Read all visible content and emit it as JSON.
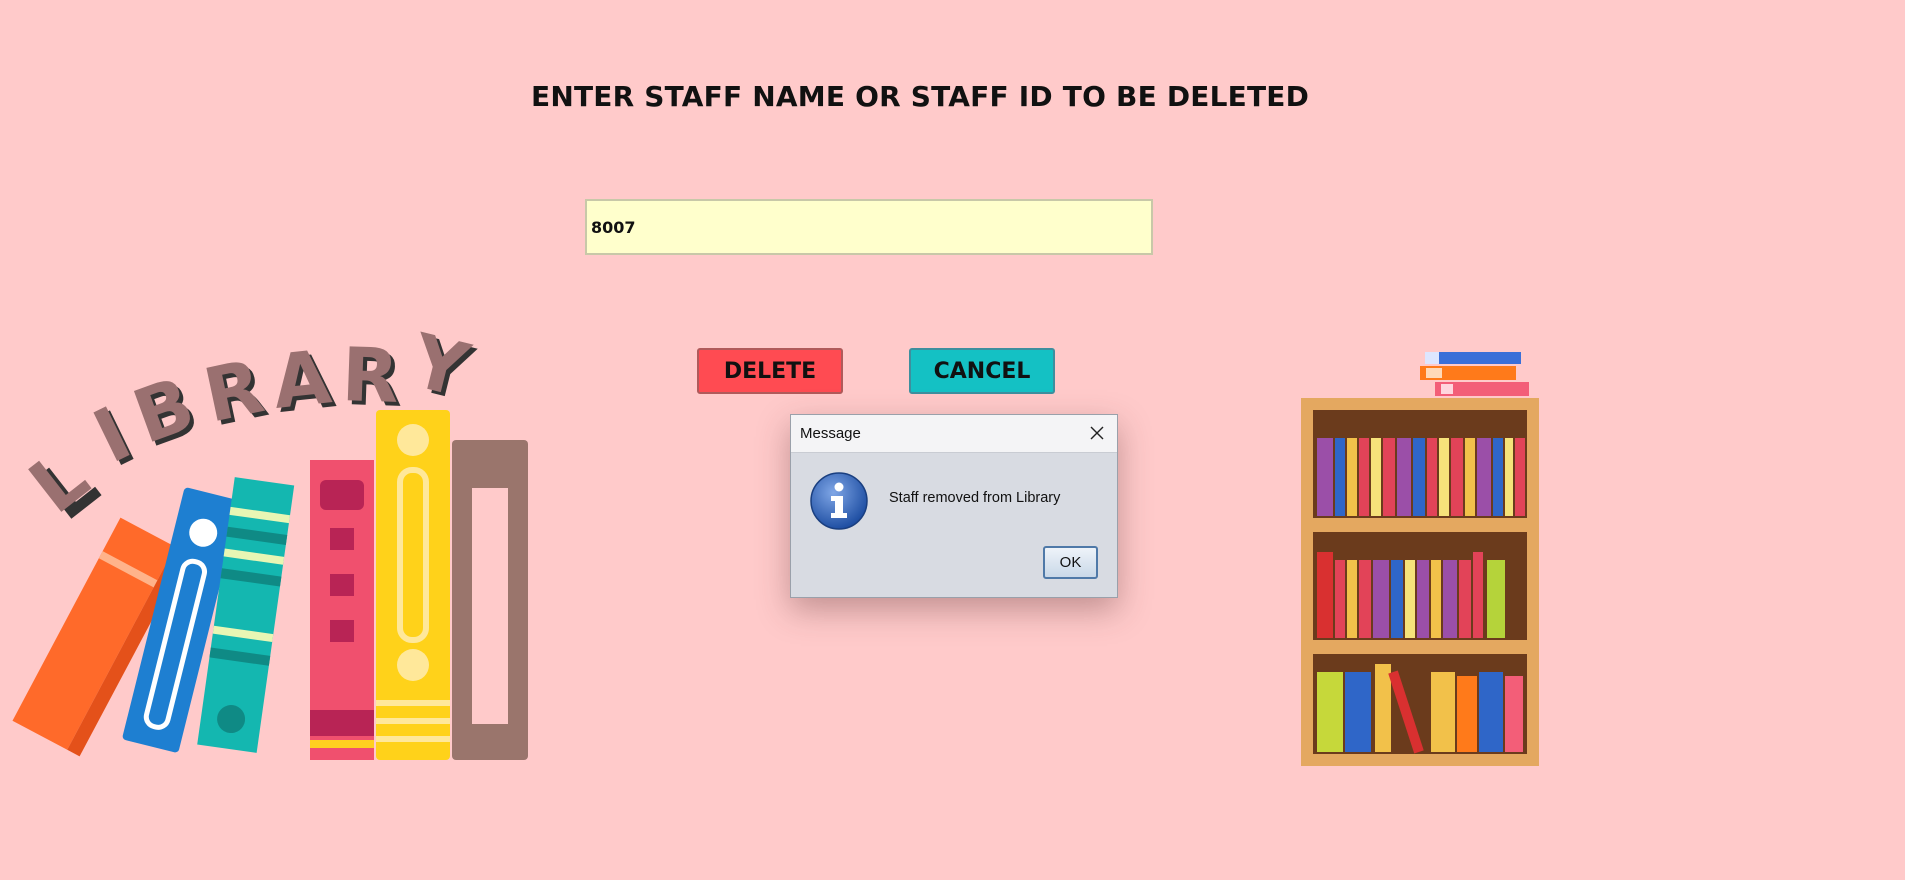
{
  "form": {
    "heading": "ENTER STAFF NAME OR STAFF ID TO BE DELETED",
    "staff_input_value": "8007",
    "delete_label": "DELETE",
    "cancel_label": "CANCEL"
  },
  "dialog": {
    "title": "Message",
    "message": "Staff removed from Library",
    "ok_label": "OK",
    "icon": "info-icon"
  },
  "illustrations": {
    "left_logo_text": "LIBRARY",
    "left_image": "library-books-illustration",
    "right_image": "bookshelf-illustration"
  },
  "colors": {
    "background": "#ffcaca",
    "delete_button": "#ff4b52",
    "cancel_button": "#14c1c4",
    "input_background": "#ffffcc"
  }
}
